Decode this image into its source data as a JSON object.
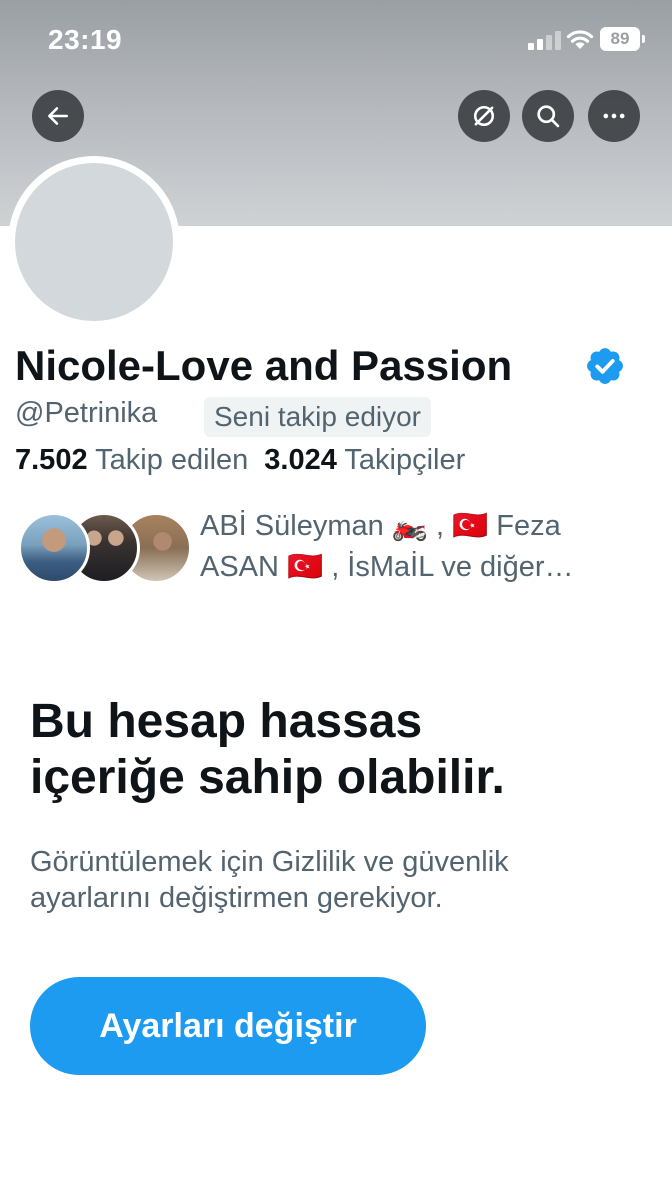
{
  "status_bar": {
    "time": "23:19",
    "battery": "89",
    "signal_icon": "cellular-signal-icon",
    "wifi_icon": "wifi-icon"
  },
  "header": {
    "back_icon": "arrow-left-icon",
    "grok_icon": "grok-icon",
    "search_icon": "search-icon",
    "more_icon": "more-horizontal-icon"
  },
  "profile": {
    "display_name": "Nicole-Love and Passion",
    "verified_icon": "verified-badge-icon",
    "handle": "@Petrinika",
    "follows_you_label": "Seni takip ediyor",
    "following_count": "7.502",
    "following_label": "Takip edilen",
    "followers_count": "3.024",
    "followers_label": "Takipçiler"
  },
  "mutual_followers": {
    "line1": "ABİ Süleyman 🏍️ , 🇹🇷 Feza",
    "line2": "ASAN 🇹🇷 , İsMaİL ve diğer…"
  },
  "sensitive_notice": {
    "headline_line1": "Bu hesap hassas",
    "headline_line2": "içeriğe sahip olabilir.",
    "subtext_line1": "Görüntülemek için Gizlilik ve güvenlik",
    "subtext_line2": "ayarlarını değiştirmen gerekiyor.",
    "button_label": "Ayarları değiştir"
  },
  "colors": {
    "accent": "#1d9bf0",
    "text_primary": "#0f1419",
    "text_secondary": "#536471",
    "banner": "#b4b8bc",
    "avatar_placeholder": "#d3d8dc"
  }
}
